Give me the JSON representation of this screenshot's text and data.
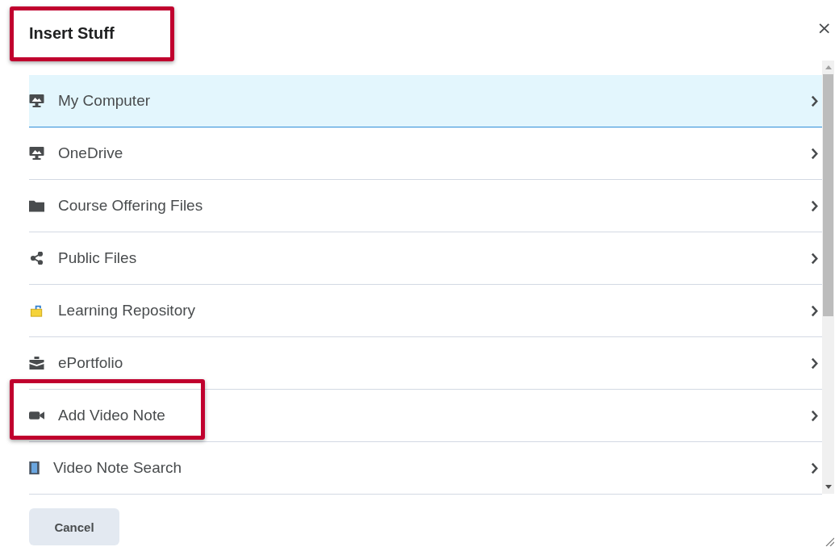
{
  "dialog": {
    "title": "Insert Stuff",
    "title_highlighted": true,
    "close": "×"
  },
  "items": [
    {
      "label": "My Computer",
      "kind": "monitor",
      "selected": true,
      "highlighted": false
    },
    {
      "label": "OneDrive",
      "kind": "monitor",
      "selected": false,
      "highlighted": false
    },
    {
      "label": "Course Offering Files",
      "kind": "folder",
      "selected": false,
      "highlighted": false
    },
    {
      "label": "Public Files",
      "kind": "share",
      "selected": false,
      "highlighted": false
    },
    {
      "label": "Learning Repository",
      "kind": "repository",
      "selected": false,
      "highlighted": false
    },
    {
      "label": "ePortfolio",
      "kind": "briefcase",
      "selected": false,
      "highlighted": false
    },
    {
      "label": "Add Video Note",
      "kind": "camera",
      "selected": false,
      "highlighted": true
    },
    {
      "label": "Video Note Search",
      "kind": "film",
      "selected": false,
      "highlighted": false
    }
  ],
  "buttons": [
    "Cancel"
  ]
}
